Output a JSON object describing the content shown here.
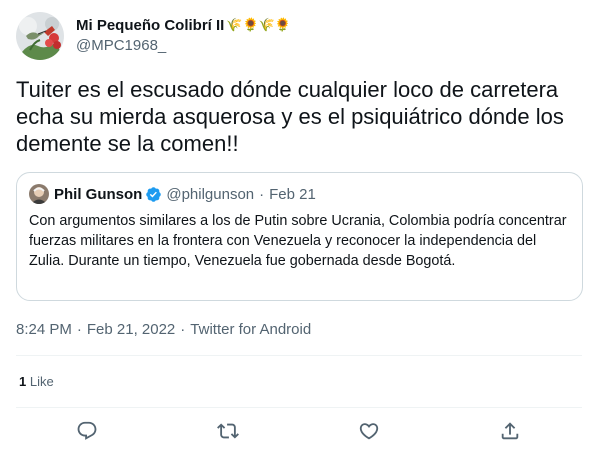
{
  "author": {
    "display_name": "Mi Pequeño Colibrí II",
    "name_emojis": "🌾🌻🌾🌻",
    "handle": "@MPC1968_",
    "avatar_icon": "hummingbird-flower-avatar"
  },
  "tweet": {
    "text": "Tuiter es el escusado dónde cualquier loco de carretera echa su mierda asquerosa y es el psiquiátrico dónde los demente se la comen!!"
  },
  "quoted_tweet": {
    "author_name": "Phil Gunson",
    "verified": true,
    "handle": "@philgunson",
    "separator": "·",
    "date": "Feb 21",
    "text": "Con argumentos similares a los de Putin sobre Ucrania, Colombia podría concentrar fuerzas militares en la frontera con Venezuela y reconocer la independencia del Zulia. Durante un tiempo, Venezuela fue gobernada desde Bogotá."
  },
  "meta": {
    "time": "8:24 PM",
    "separator": "·",
    "date": "Feb 21, 2022",
    "source": "Twitter for Android"
  },
  "stats": {
    "like_count": "1",
    "like_label": "Like"
  },
  "actions": [
    {
      "icon": "reply-icon"
    },
    {
      "icon": "retweet-icon"
    },
    {
      "icon": "like-heart-icon"
    },
    {
      "icon": "share-icon"
    }
  ],
  "colors": {
    "text": "#0f1419",
    "secondary": "#536471",
    "border": "#cfd9de",
    "verified": "#1d9bf0"
  }
}
